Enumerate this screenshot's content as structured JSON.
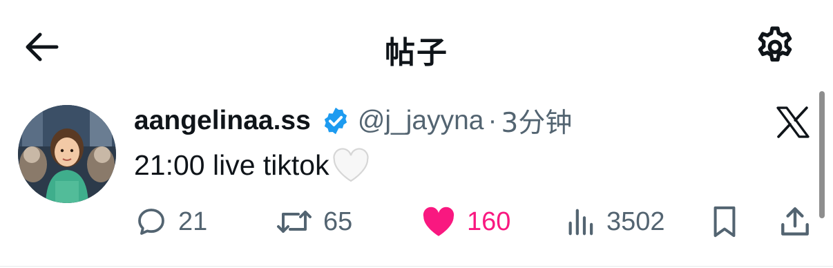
{
  "header": {
    "title": "帖子",
    "back_icon": "arrow-left-icon",
    "settings_icon": "gear-icon"
  },
  "tweet": {
    "display_name": "aangelinaa.ss",
    "handle": "@j_jayyna",
    "separator": "·",
    "time": "3分钟",
    "verified": true,
    "verified_color": "#1d9bf0",
    "text": "21:00 live tiktok",
    "emoji": "white-heart-emoji",
    "source_icon": "x-logo-icon"
  },
  "actions": {
    "replies": "21",
    "reposts": "65",
    "likes": "160",
    "views": "3502",
    "liked": true,
    "like_color": "#f91880",
    "muted_color": "#536471"
  }
}
